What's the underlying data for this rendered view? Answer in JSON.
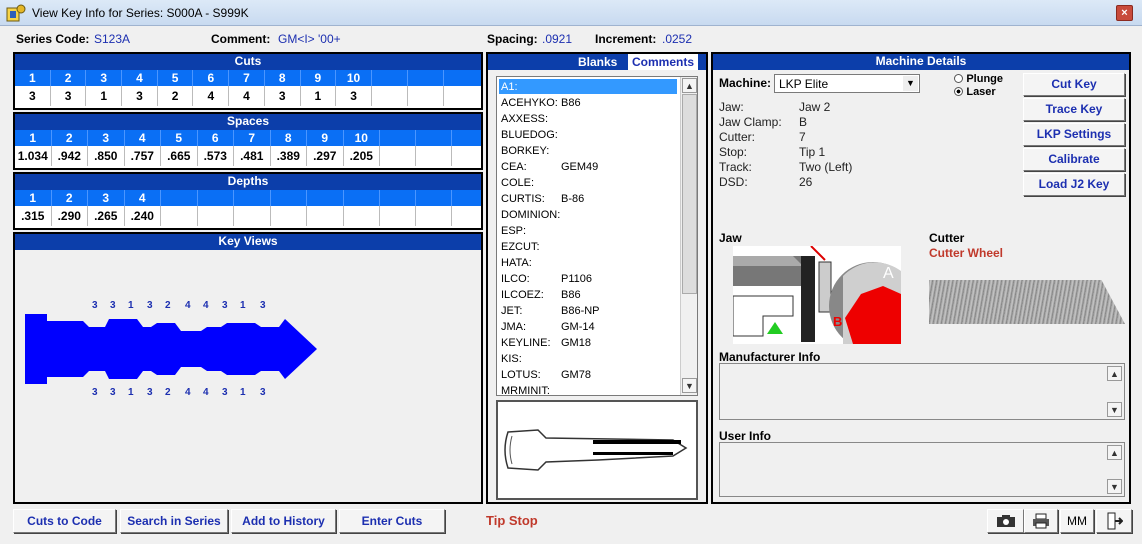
{
  "window": {
    "title": "View Key Info for Series: S000A - S999K",
    "close": "×"
  },
  "header": {
    "series_label": "Series Code:",
    "series_value": "S123A",
    "comment_label": "Comment:",
    "comment_value": "GM<I> '00+",
    "spacing_label": "Spacing:",
    "spacing_value": ".0921",
    "increment_label": "Increment:",
    "increment_value": ".0252"
  },
  "cuts": {
    "title": "Cuts",
    "numbers": [
      "1",
      "2",
      "3",
      "4",
      "5",
      "6",
      "7",
      "8",
      "9",
      "10",
      "",
      ""
    ],
    "values": [
      "3",
      "3",
      "1",
      "3",
      "2",
      "4",
      "4",
      "3",
      "1",
      "3",
      "",
      ""
    ]
  },
  "spaces": {
    "title": "Spaces",
    "numbers": [
      "1",
      "2",
      "3",
      "4",
      "5",
      "6",
      "7",
      "8",
      "9",
      "10",
      "",
      ""
    ],
    "values": [
      "1.034",
      ".942",
      ".850",
      ".757",
      ".665",
      ".573",
      ".481",
      ".389",
      ".297",
      ".205",
      "",
      ""
    ]
  },
  "depths": {
    "title": "Depths",
    "numbers": [
      "1",
      "2",
      "3",
      "4",
      "",
      "",
      "",
      "",
      "",
      "",
      "",
      ""
    ],
    "values": [
      ".315",
      ".290",
      ".265",
      ".240",
      "",
      "",
      "",
      "",
      "",
      "",
      "",
      ""
    ]
  },
  "key_views": {
    "title": "Key Views",
    "top_cuts": [
      "3",
      "3",
      "1",
      "3",
      "2",
      "4",
      "4",
      "3",
      "1",
      "3"
    ],
    "bottom_cuts": [
      "3",
      "3",
      "1",
      "3",
      "2",
      "4",
      "4",
      "3",
      "1",
      "3"
    ],
    "key_color": "#0000ff"
  },
  "blanks": {
    "tab_blanks": "Blanks",
    "tab_comments": "Comments",
    "items": [
      {
        "name": "A1:",
        "value": ""
      },
      {
        "name": "ACEHYKO:",
        "value": "B86"
      },
      {
        "name": "AXXESS:",
        "value": ""
      },
      {
        "name": "BLUEDOG:",
        "value": ""
      },
      {
        "name": "BORKEY:",
        "value": ""
      },
      {
        "name": "CEA:",
        "value": "GEM49"
      },
      {
        "name": "COLE:",
        "value": ""
      },
      {
        "name": "CURTIS:",
        "value": "B-86"
      },
      {
        "name": "DOMINION:",
        "value": ""
      },
      {
        "name": "ESP:",
        "value": ""
      },
      {
        "name": "EZCUT:",
        "value": ""
      },
      {
        "name": "HATA:",
        "value": ""
      },
      {
        "name": "ILCO:",
        "value": "P1106"
      },
      {
        "name": "ILCOEZ:",
        "value": "B86"
      },
      {
        "name": "JET:",
        "value": "B86-NP"
      },
      {
        "name": "JMA:",
        "value": "GM-14"
      },
      {
        "name": "KEYLINE:",
        "value": "GM18"
      },
      {
        "name": "KIS:",
        "value": ""
      },
      {
        "name": "LOTUS:",
        "value": "GM78"
      },
      {
        "name": "MRMINIT:",
        "value": ""
      }
    ]
  },
  "machine": {
    "title": "Machine Details",
    "machine_label": "Machine:",
    "machine_value": "LKP Elite",
    "plunge_label": "Plunge",
    "laser_label": "Laser",
    "details": [
      {
        "label": "Jaw:",
        "value": "Jaw 2"
      },
      {
        "label": "Jaw Clamp:",
        "value": "B"
      },
      {
        "label": "Cutter:",
        "value": "7"
      },
      {
        "label": "Stop:",
        "value": "Tip 1"
      },
      {
        "label": "Track:",
        "value": "Two (Left)"
      },
      {
        "label": "DSD:",
        "value": "26"
      }
    ],
    "buttons": [
      "Cut Key",
      "Trace Key",
      "LKP Settings",
      "Calibrate",
      "Load J2 Key"
    ],
    "jaw_label": "Jaw",
    "cutter_label": "Cutter",
    "cutter_value": "Cutter Wheel",
    "jaw_marker_a": "A",
    "jaw_marker_b": "B",
    "manufacturer_label": "Manufacturer Info",
    "user_label": "User Info"
  },
  "footer": {
    "buttons": [
      "Cuts to Code",
      "Search in Series",
      "Add to History",
      "Enter Cuts"
    ],
    "status": "Tip Stop",
    "mm_label": "MM"
  },
  "colors": {
    "panel_header": "#0c3eaa",
    "number_row": "#0a6ff5",
    "accent_text": "#1c2fb0",
    "status_red": "#c0392b"
  }
}
